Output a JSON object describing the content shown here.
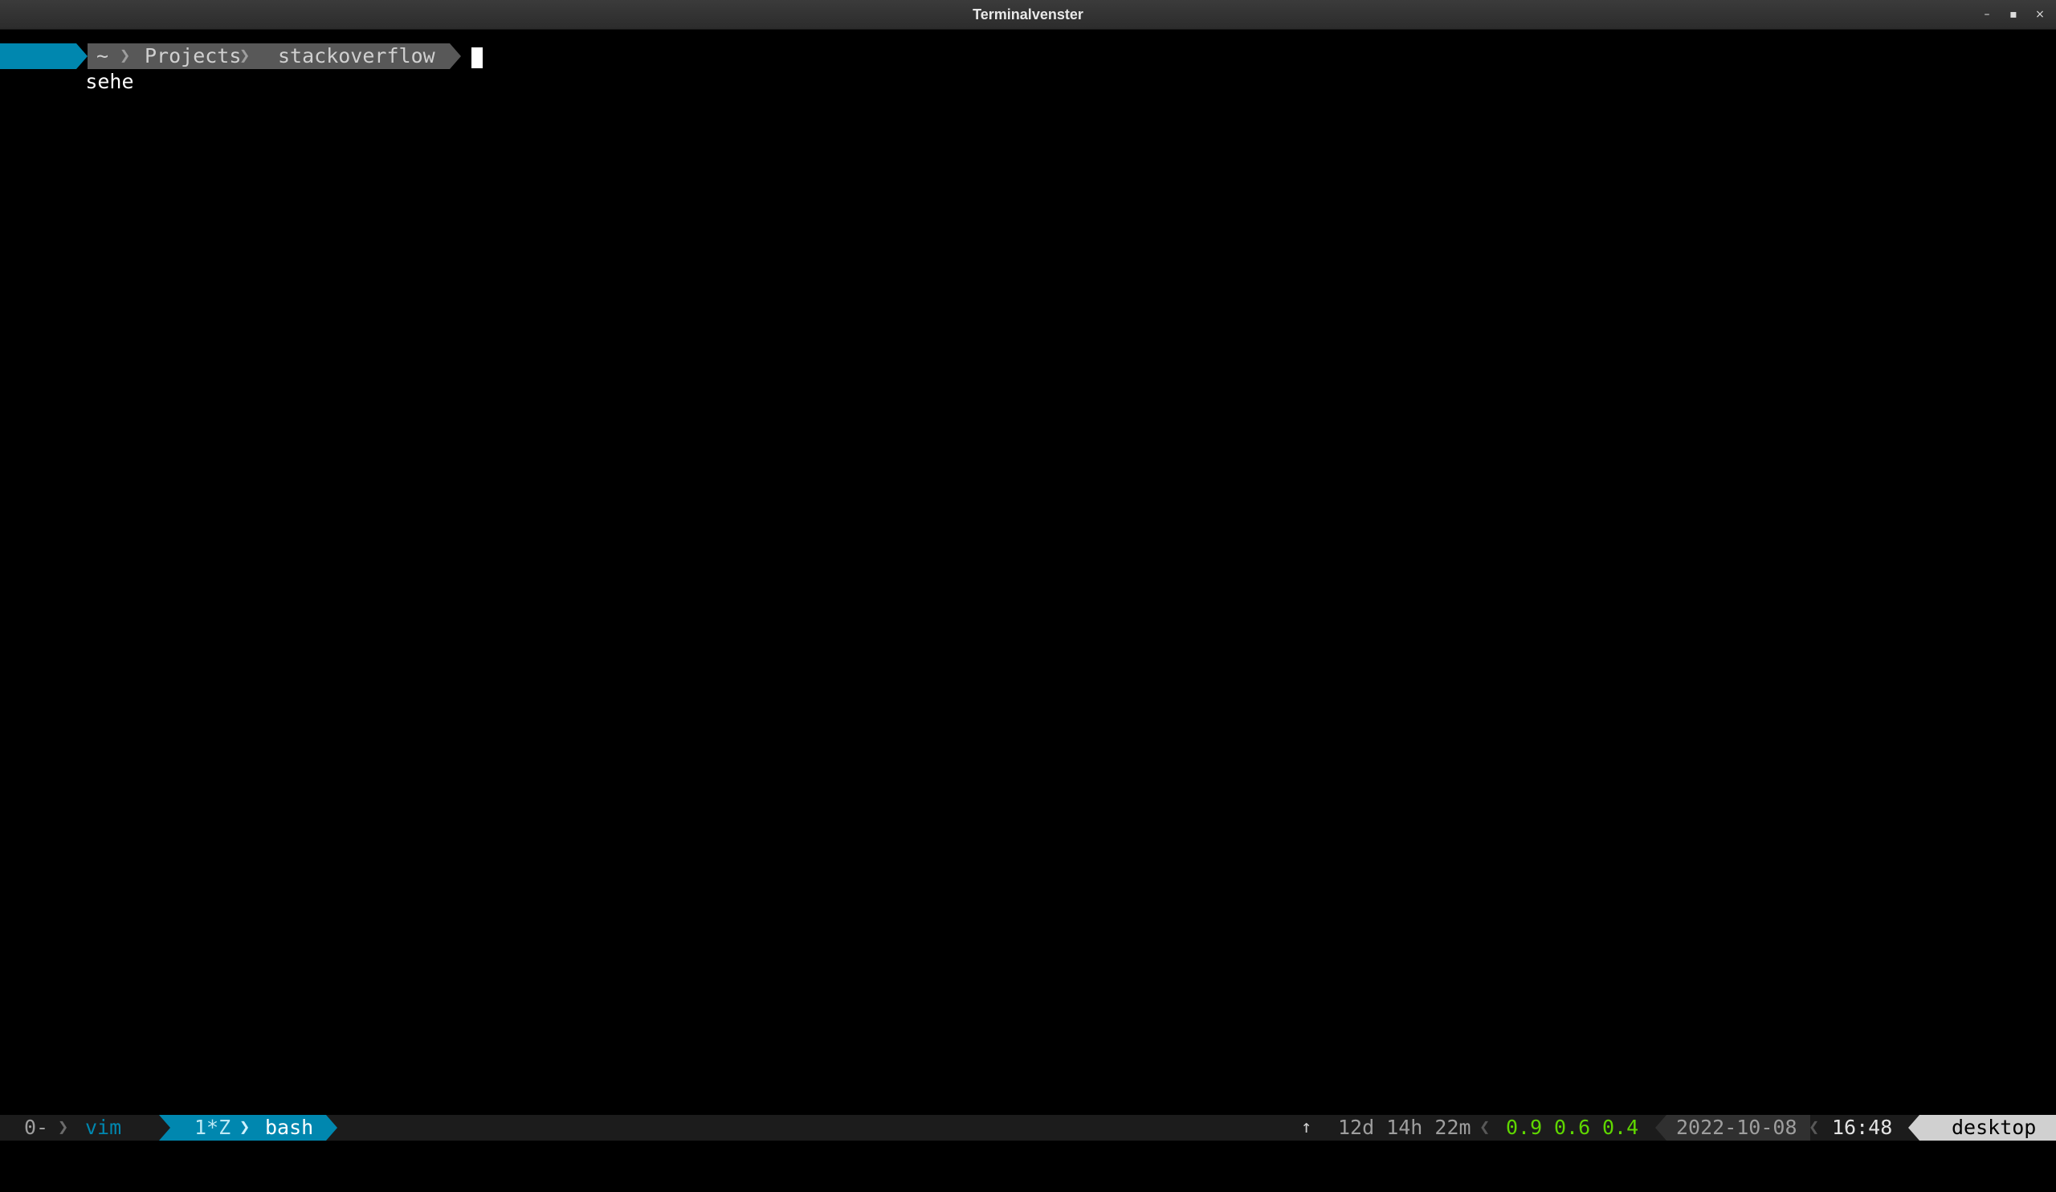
{
  "window": {
    "title": "Terminalvenster",
    "minimize_glyph": "–",
    "maximize_glyph": "▪",
    "close_glyph": "×"
  },
  "prompt": {
    "user": "sehe",
    "home": "~",
    "path": [
      "Projects",
      "stackoverflow"
    ],
    "separator_glyph": "❯"
  },
  "status_bar": {
    "session": "0-",
    "window_prev": "vim",
    "window_active_index": "1*Z",
    "window_active_name": "bash",
    "uptime_icon": "↑",
    "uptime": "12d 14h 22m",
    "load": [
      "0.9",
      "0.6",
      "0.4"
    ],
    "date": "2022-10-08",
    "time": "16:48",
    "lock_icon": "🔒",
    "host": "desktop",
    "colors": {
      "accent": "#0087af",
      "load": "#5fd700",
      "path_bg": "#585858"
    }
  }
}
